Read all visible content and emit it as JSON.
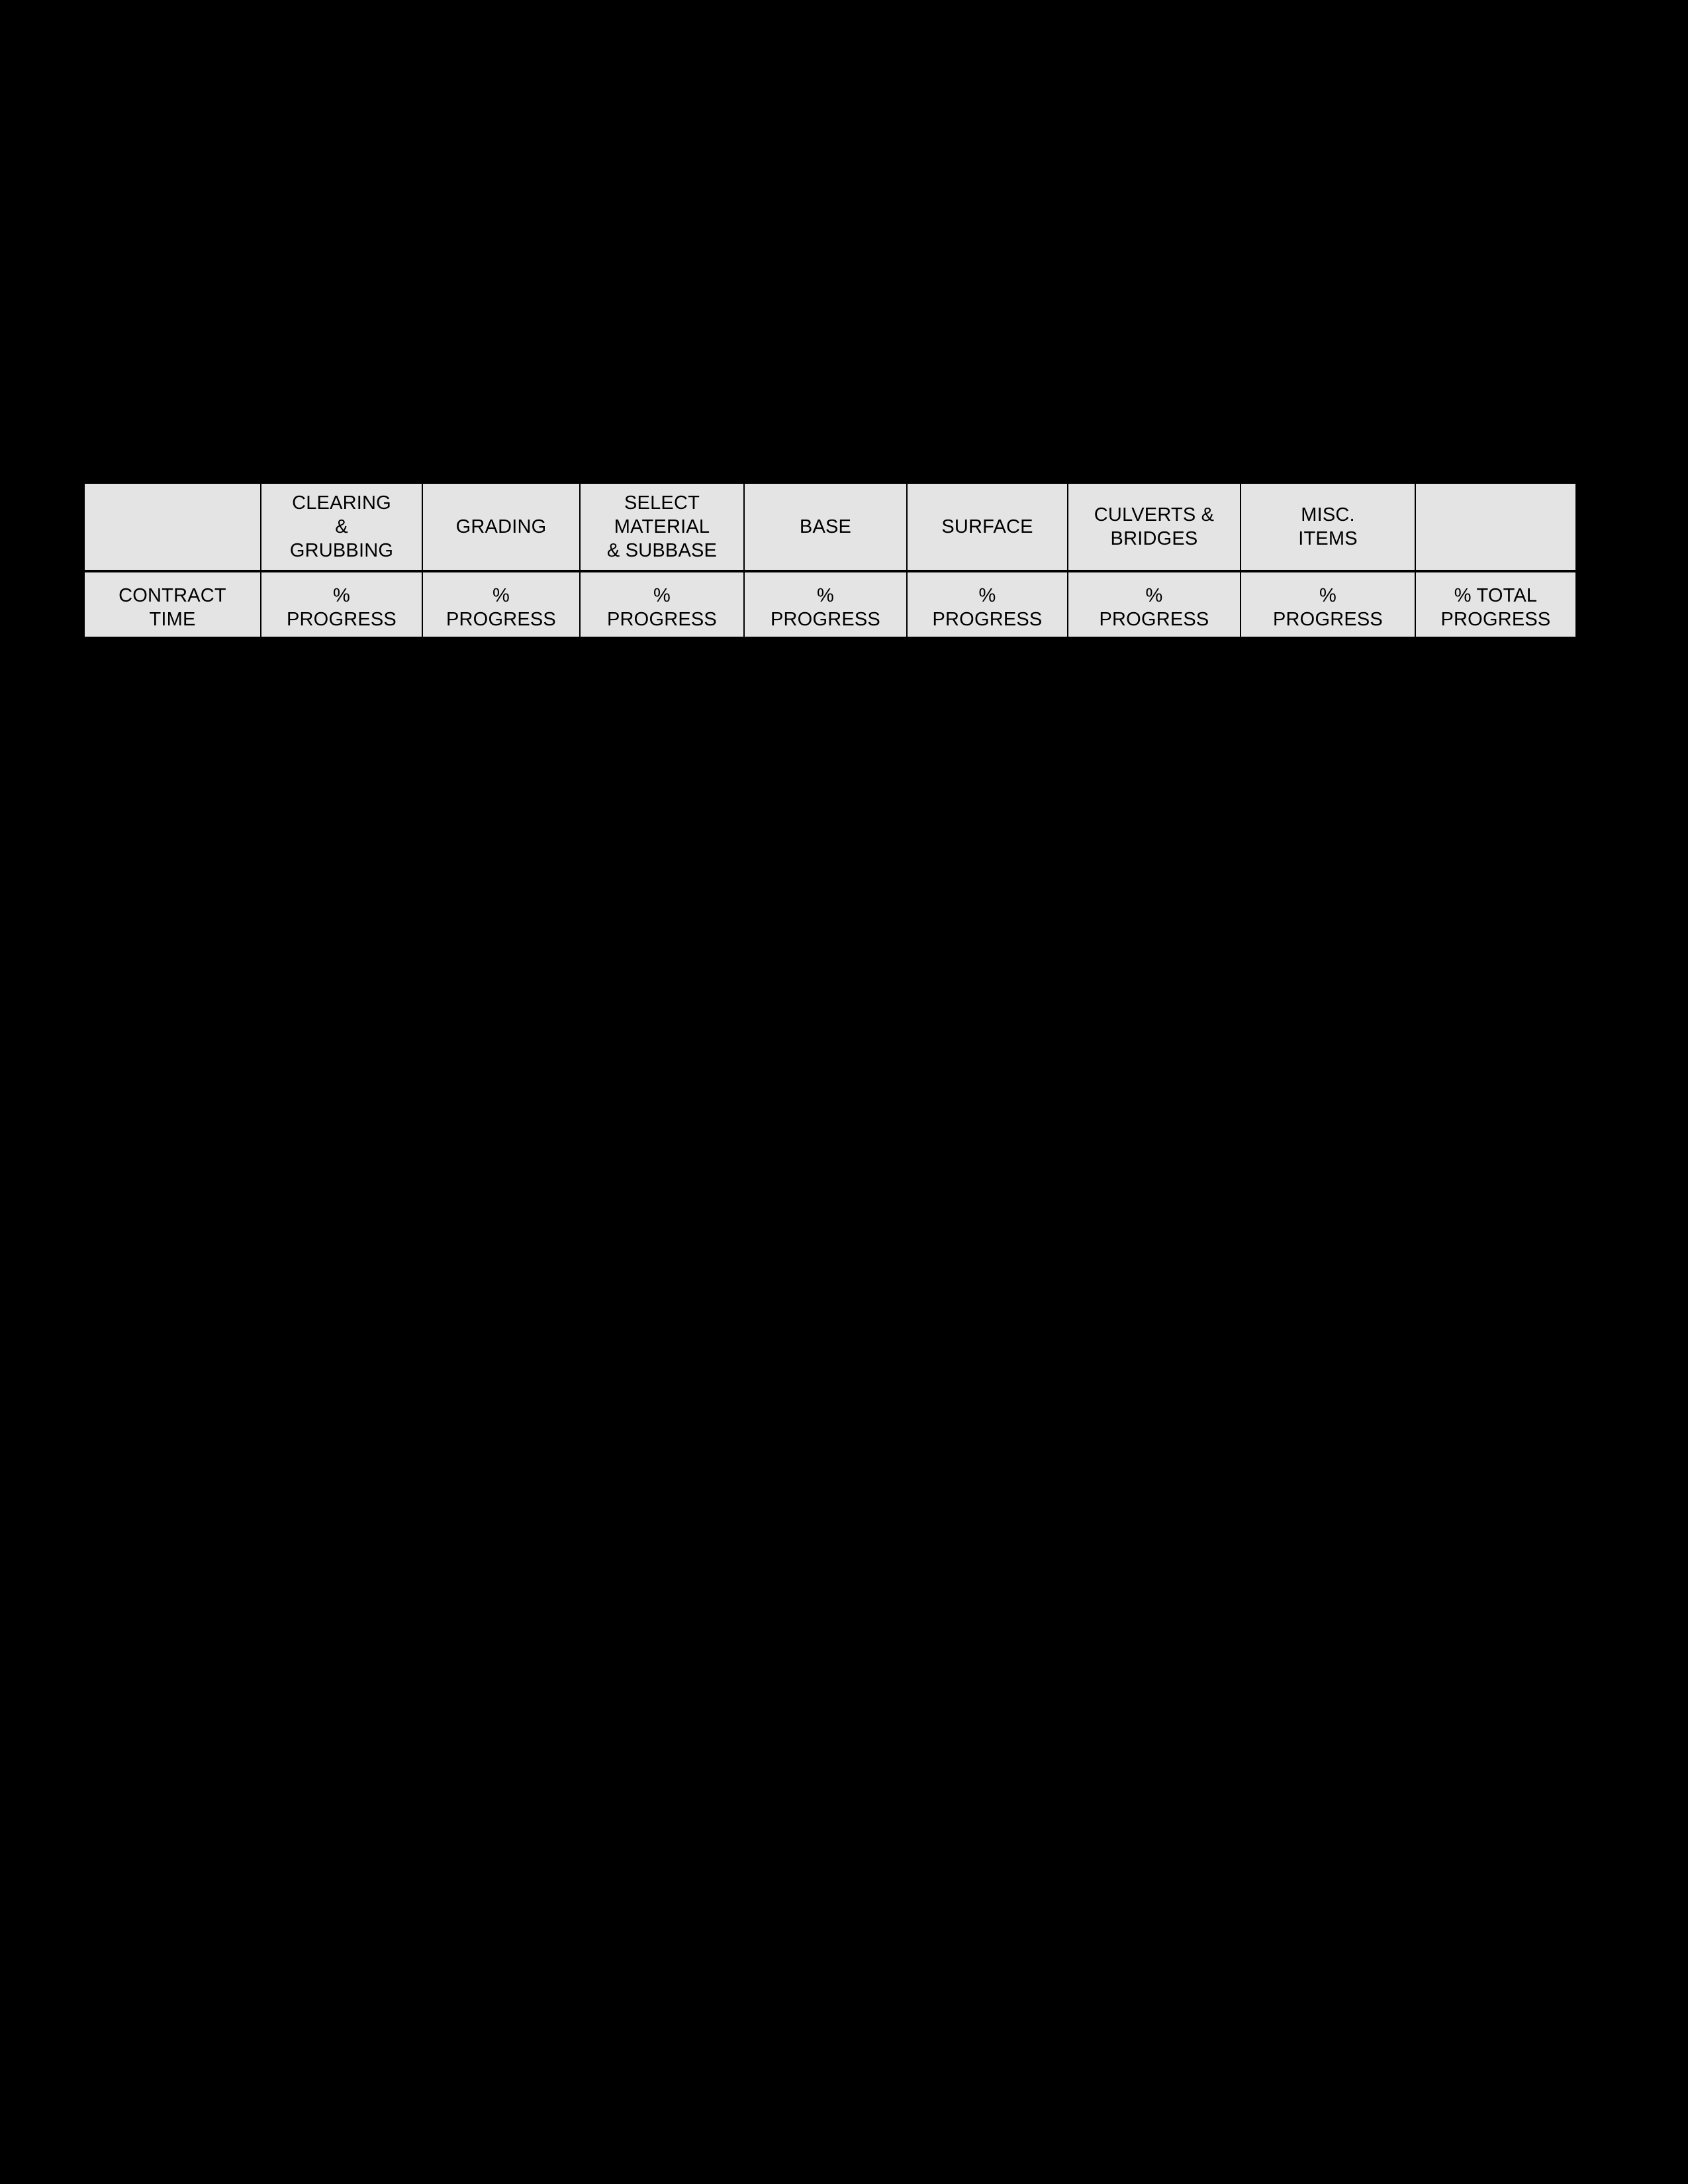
{
  "page": {
    "background_color": "#000000",
    "table_fill_color": "#e4e4e4",
    "rule_color": "#000000"
  },
  "table": {
    "name": "construction-progress-header-table",
    "column_count": 9,
    "row_count": 2,
    "columns": [
      {
        "index": 0,
        "group_label": "",
        "group_lines": [],
        "measure_label": "CONTRACT TIME",
        "measure_lines": [
          "CONTRACT",
          "TIME"
        ]
      },
      {
        "index": 1,
        "group_label": "CLEARING & GRUBBING",
        "group_lines": [
          "CLEARING",
          "&",
          "GRUBBING"
        ],
        "measure_label": "% PROGRESS",
        "measure_lines": [
          "%",
          "PROGRESS"
        ]
      },
      {
        "index": 2,
        "group_label": "GRADING",
        "group_lines": [
          "GRADING"
        ],
        "measure_label": "% PROGRESS",
        "measure_lines": [
          "%",
          "PROGRESS"
        ]
      },
      {
        "index": 3,
        "group_label": "SELECT MATERIAL & SUBBASE",
        "group_lines": [
          "SELECT",
          "MATERIAL",
          "& SUBBASE"
        ],
        "measure_label": "% PROGRESS",
        "measure_lines": [
          "%",
          "PROGRESS"
        ]
      },
      {
        "index": 4,
        "group_label": "BASE",
        "group_lines": [
          "BASE"
        ],
        "measure_label": "% PROGRESS",
        "measure_lines": [
          "%",
          "PROGRESS"
        ]
      },
      {
        "index": 5,
        "group_label": "SURFACE",
        "group_lines": [
          "SURFACE"
        ],
        "measure_label": "% PROGRESS",
        "measure_lines": [
          "%",
          "PROGRESS"
        ]
      },
      {
        "index": 6,
        "group_label": "CULVERTS & BRIDGES",
        "group_lines": [
          "CULVERTS &",
          "BRIDGES"
        ],
        "measure_label": "% PROGRESS",
        "measure_lines": [
          "%",
          "PROGRESS"
        ]
      },
      {
        "index": 7,
        "group_label": "MISC. ITEMS",
        "group_lines": [
          "MISC.",
          "ITEMS"
        ],
        "measure_label": "% PROGRESS",
        "measure_lines": [
          "%",
          "PROGRESS"
        ]
      },
      {
        "index": 8,
        "group_label": "",
        "group_lines": [],
        "measure_label": "% TOTAL PROGRESS",
        "measure_lines": [
          "% TOTAL",
          "PROGRESS"
        ]
      }
    ]
  }
}
